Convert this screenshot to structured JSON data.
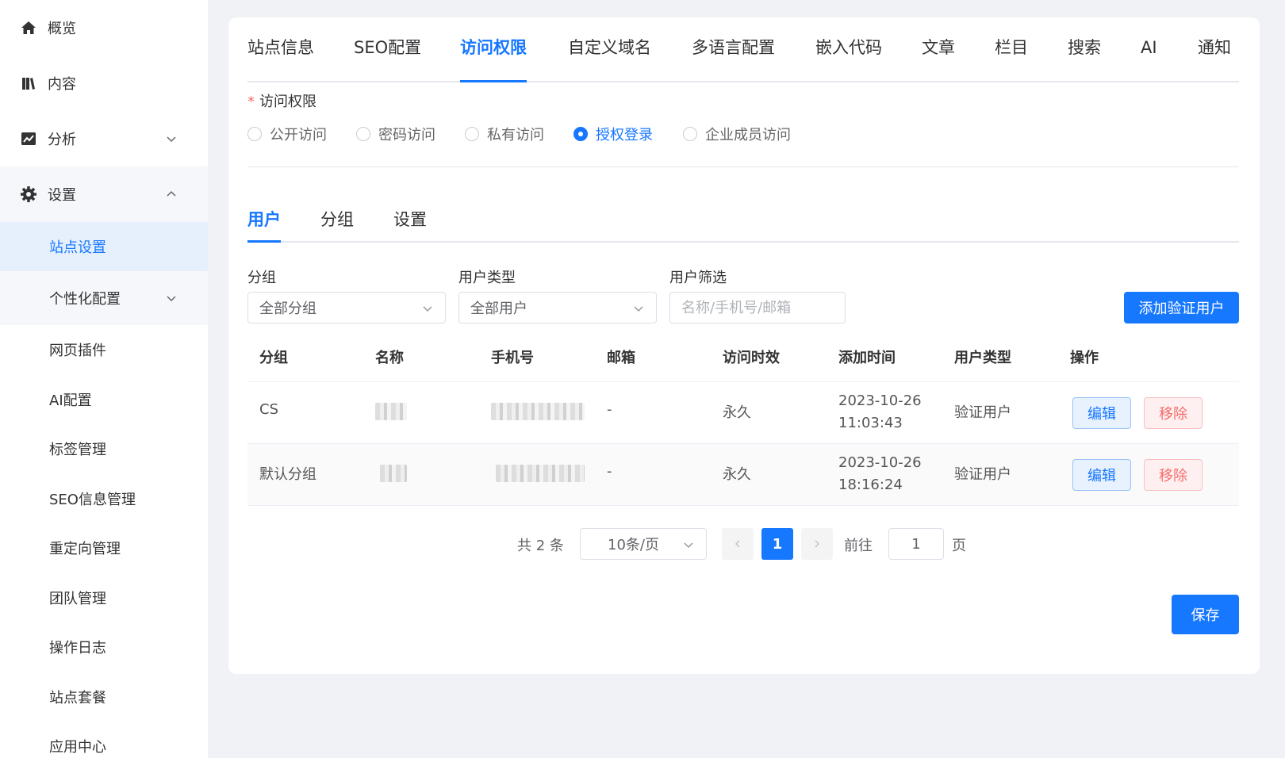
{
  "sidebar": {
    "top_items": [
      {
        "label": "概览",
        "icon": "home-icon"
      },
      {
        "label": "内容",
        "icon": "content-icon"
      },
      {
        "label": "分析",
        "icon": "chart-icon"
      },
      {
        "label": "设置",
        "icon": "gear-icon"
      }
    ],
    "sub_items": [
      {
        "label": "站点设置"
      },
      {
        "label": "个性化配置"
      },
      {
        "label": "网页插件"
      },
      {
        "label": "AI配置"
      },
      {
        "label": "标签管理"
      },
      {
        "label": "SEO信息管理"
      },
      {
        "label": "重定向管理"
      },
      {
        "label": "团队管理"
      },
      {
        "label": "操作日志"
      },
      {
        "label": "站点套餐"
      },
      {
        "label": "应用中心"
      }
    ]
  },
  "top_tabs": [
    "站点信息",
    "SEO配置",
    "访问权限",
    "自定义域名",
    "多语言配置",
    "嵌入代码",
    "文章",
    "栏目",
    "搜索",
    "AI",
    "通知"
  ],
  "access": {
    "required_mark": "*",
    "label": "访问权限",
    "options": [
      "公开访问",
      "密码访问",
      "私有访问",
      "授权登录",
      "企业成员访问"
    ],
    "selected": "授权登录"
  },
  "sub_tabs": [
    "用户",
    "分组",
    "设置"
  ],
  "filters": {
    "group_label": "分组",
    "group_value": "全部分组",
    "type_label": "用户类型",
    "type_value": "全部用户",
    "search_label": "用户筛选",
    "search_placeholder": "名称/手机号/邮箱",
    "add_button": "添加验证用户"
  },
  "table": {
    "headers": [
      "分组",
      "名称",
      "手机号",
      "邮箱",
      "访问时效",
      "添加时间",
      "用户类型",
      "操作"
    ],
    "rows": [
      {
        "group": "CS",
        "email": "-",
        "validity": "永久",
        "date": "2023-10-26",
        "time": "11:03:43",
        "type": "验证用户",
        "edit": "编辑",
        "remove": "移除"
      },
      {
        "group": "默认分组",
        "email": "-",
        "validity": "永久",
        "date": "2023-10-26",
        "time": "18:16:24",
        "type": "验证用户",
        "edit": "编辑",
        "remove": "移除"
      }
    ]
  },
  "pagination": {
    "total": "共 2 条",
    "page_size": "10条/页",
    "current_page": "1",
    "goto_label": "前往",
    "goto_value": "1",
    "page_suffix": "页"
  },
  "save_button": "保存",
  "colors": {
    "accent": "#1677ff",
    "danger": "#f56c6c",
    "background": "#f0f2f5"
  }
}
